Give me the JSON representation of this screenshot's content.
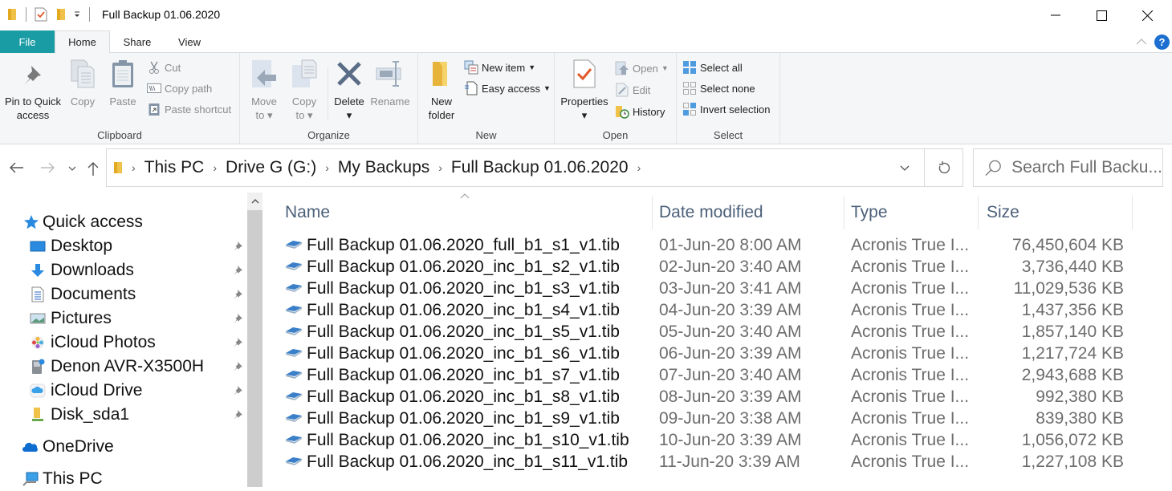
{
  "window": {
    "title": "Full Backup 01.06.2020",
    "controls": {
      "minimize": "minimize-icon",
      "maximize": "maximize-icon",
      "close": "close-icon"
    }
  },
  "ribbon_tabs": [
    {
      "label": "File"
    },
    {
      "label": "Home",
      "active": true
    },
    {
      "label": "Share"
    },
    {
      "label": "View"
    }
  ],
  "ribbon": {
    "clipboard": {
      "label": "Clipboard",
      "pin": "Pin to Quick\naccess",
      "pin_l1": "Pin to Quick",
      "pin_l2": "access",
      "copy": "Copy",
      "paste": "Paste",
      "cut": "Cut",
      "copy_path": "Copy path",
      "paste_shortcut": "Paste shortcut"
    },
    "organize": {
      "label": "Organize",
      "move_l1": "Move",
      "move_l2": "to",
      "copy_l1": "Copy",
      "copy_l2": "to",
      "delete": "Delete",
      "rename": "Rename"
    },
    "new": {
      "label": "New",
      "new_folder_l1": "New",
      "new_folder_l2": "folder",
      "new_item": "New item",
      "easy_access": "Easy access"
    },
    "open": {
      "label": "Open",
      "properties": "Properties",
      "open": "Open",
      "edit": "Edit",
      "history": "History"
    },
    "select": {
      "label": "Select",
      "select_all": "Select all",
      "select_none": "Select none",
      "invert": "Invert selection"
    }
  },
  "address": {
    "crumbs": [
      "This PC",
      "Drive G (G:)",
      "My Backups",
      "Full Backup 01.06.2020"
    ],
    "search_placeholder": "Search Full Backu..."
  },
  "nav": {
    "quick_access": "Quick access",
    "items": [
      {
        "label": "Desktop",
        "icon": "desktop-icon",
        "pinned": true
      },
      {
        "label": "Downloads",
        "icon": "downloads-icon",
        "pinned": true
      },
      {
        "label": "Documents",
        "icon": "documents-icon",
        "pinned": true
      },
      {
        "label": "Pictures",
        "icon": "pictures-icon",
        "pinned": true
      },
      {
        "label": "iCloud Photos",
        "icon": "icloud-photos-icon",
        "pinned": true
      },
      {
        "label": "Denon AVR-X3500H",
        "icon": "media-device-icon",
        "pinned": true
      },
      {
        "label": "iCloud Drive",
        "icon": "icloud-drive-icon",
        "pinned": true
      },
      {
        "label": "Disk_sda1",
        "icon": "network-folder-icon",
        "pinned": true
      }
    ],
    "onedrive": "OneDrive",
    "this_pc": "This PC"
  },
  "columns": {
    "name": "Name",
    "date": "Date modified",
    "type": "Type",
    "size": "Size"
  },
  "files": [
    {
      "name": "Full Backup 01.06.2020_full_b1_s1_v1.tib",
      "date": "01-Jun-20 8:00 AM",
      "type": "Acronis True I...",
      "size": "76,450,604 KB"
    },
    {
      "name": "Full Backup 01.06.2020_inc_b1_s2_v1.tib",
      "date": "02-Jun-20 3:40 AM",
      "type": "Acronis True I...",
      "size": "3,736,440 KB"
    },
    {
      "name": "Full Backup 01.06.2020_inc_b1_s3_v1.tib",
      "date": "03-Jun-20 3:41 AM",
      "type": "Acronis True I...",
      "size": "11,029,536 KB"
    },
    {
      "name": "Full Backup 01.06.2020_inc_b1_s4_v1.tib",
      "date": "04-Jun-20 3:39 AM",
      "type": "Acronis True I...",
      "size": "1,437,356 KB"
    },
    {
      "name": "Full Backup 01.06.2020_inc_b1_s5_v1.tib",
      "date": "05-Jun-20 3:40 AM",
      "type": "Acronis True I...",
      "size": "1,857,140 KB"
    },
    {
      "name": "Full Backup 01.06.2020_inc_b1_s6_v1.tib",
      "date": "06-Jun-20 3:39 AM",
      "type": "Acronis True I...",
      "size": "1,217,724 KB"
    },
    {
      "name": "Full Backup 01.06.2020_inc_b1_s7_v1.tib",
      "date": "07-Jun-20 3:40 AM",
      "type": "Acronis True I...",
      "size": "2,943,688 KB"
    },
    {
      "name": "Full Backup 01.06.2020_inc_b1_s8_v1.tib",
      "date": "08-Jun-20 3:39 AM",
      "type": "Acronis True I...",
      "size": "992,380 KB"
    },
    {
      "name": "Full Backup 01.06.2020_inc_b1_s9_v1.tib",
      "date": "09-Jun-20 3:38 AM",
      "type": "Acronis True I...",
      "size": "839,380 KB"
    },
    {
      "name": "Full Backup 01.06.2020_inc_b1_s10_v1.tib",
      "date": "10-Jun-20 3:39 AM",
      "type": "Acronis True I...",
      "size": "1,056,072 KB"
    },
    {
      "name": "Full Backup 01.06.2020_inc_b1_s11_v1.tib",
      "date": "11-Jun-20 3:39 AM",
      "type": "Acronis True I...",
      "size": "1,227,108 KB"
    }
  ],
  "colors": {
    "file_tab": "#1a9ca4",
    "help": "#1c6fd1",
    "header_text": "#4c607a"
  }
}
